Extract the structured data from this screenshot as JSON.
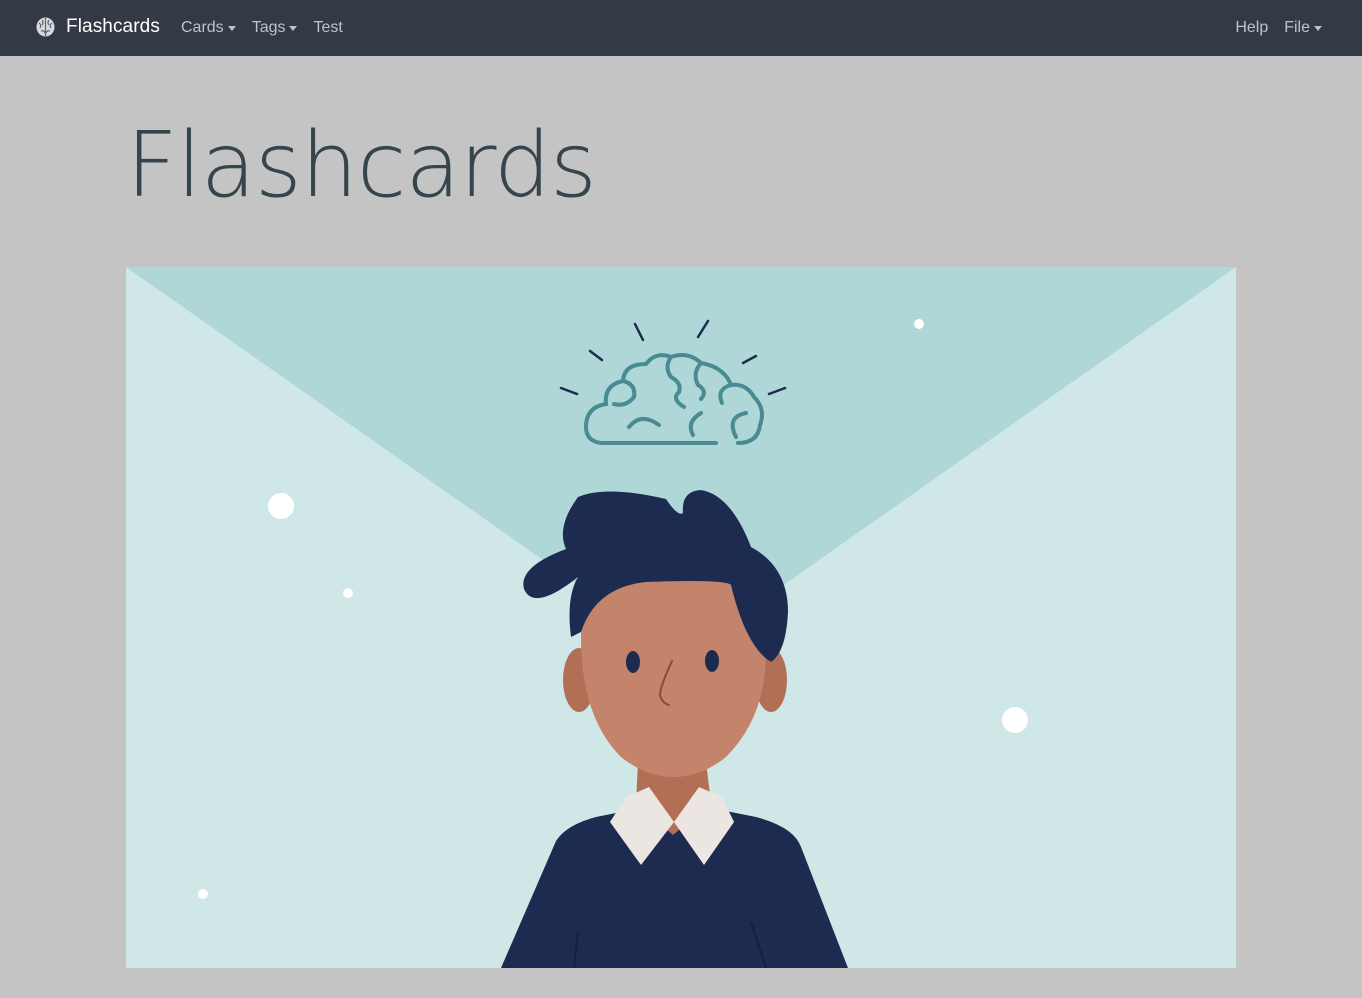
{
  "navbar": {
    "brand_label": "Flashcards",
    "brand_icon": "brain-icon",
    "left_items": [
      {
        "label": "Cards",
        "dropdown": true
      },
      {
        "label": "Tags",
        "dropdown": true
      },
      {
        "label": "Test",
        "dropdown": false
      }
    ],
    "right_items": [
      {
        "label": "Help",
        "dropdown": false
      },
      {
        "label": "File",
        "dropdown": true
      }
    ]
  },
  "main": {
    "title": "Flashcards",
    "hero_image": "person-thinking-brain-illustration"
  },
  "colors": {
    "navbar_bg": "#343a45",
    "page_bg": "#c4c4c4",
    "hero_bg": "#cfe8e7",
    "hero_beam": "#afd7d7",
    "brain_stroke": "#4a8a92",
    "hair_shirt": "#1c2b4f",
    "skin": "#c4846b"
  }
}
